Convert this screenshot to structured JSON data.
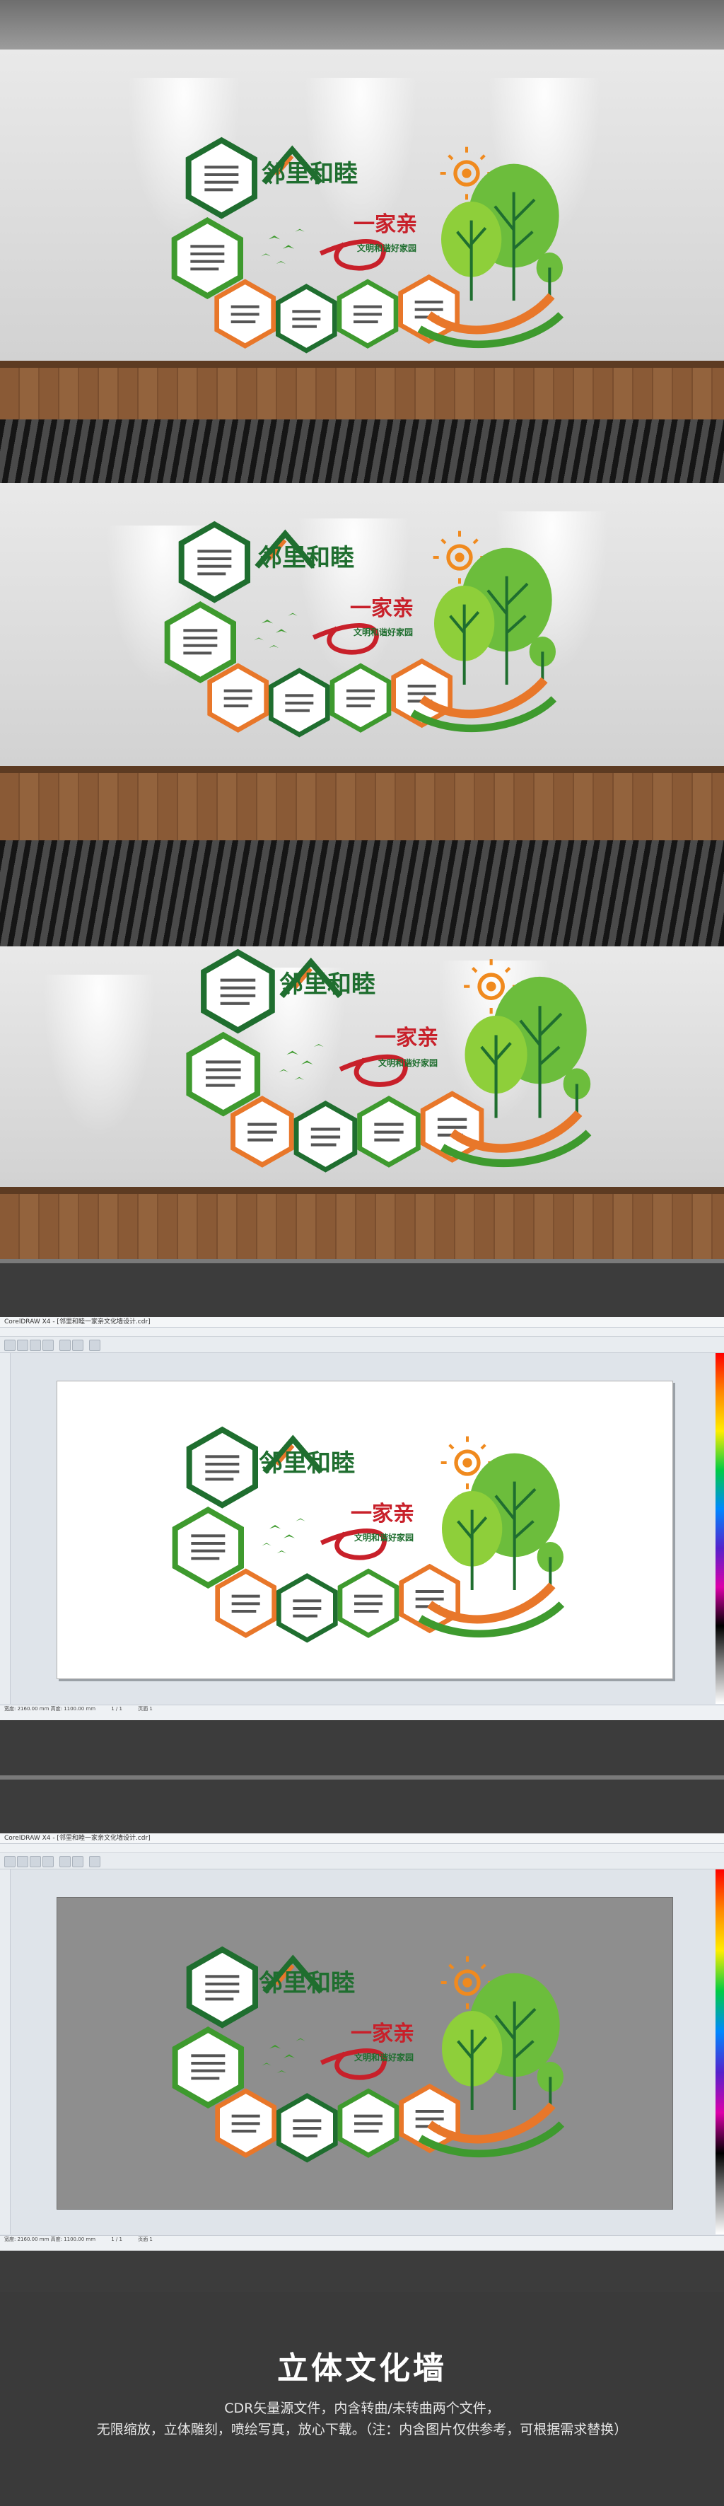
{
  "wall_design": {
    "headline_part1": "邻里和睦",
    "headline_part2": "一家亲",
    "subtitle": "文明和谐好家园",
    "hex_texts": [
      "与人为善你不争\n用心真人帮他人\n你打我帮互相助\n远亲不如近邻",
      "和睦相处是美德\n邻里互助美家园\n人在和善邻居好\n和谐社会人皆有",
      "互帮互助邻里情\n团结友善美家园",
      "和谐小区你我他\n建设靠大家",
      "与人方便自己方便\n邻里和睦一家亲",
      "人和家兴邻里好\n互帮互助共创和谐"
    ]
  },
  "software_window": {
    "title": "CorelDRAW X4 - [邻里和睦一家亲文化墙设计.cdr]",
    "status_left": "宽度: 2160.00 mm  高度: 1100.00 mm",
    "status_page": "1 / 1",
    "page_tab": "页面 1"
  },
  "footer": {
    "title": "立体文化墙",
    "desc_line1": "CDR矢量源文件，内含转曲/未转曲两个文件，",
    "desc_line2": "无限缩放，立体雕刻，喷绘写真，放心下载。（注：内含图片仅供参考，可根据需求替换）"
  },
  "colors": {
    "green_dark": "#1f6e2f",
    "green_mid": "#3e9a2e",
    "green_light": "#8ecf3a",
    "orange": "#e8772a",
    "red": "#c8202a",
    "sun": "#f08a1e"
  }
}
